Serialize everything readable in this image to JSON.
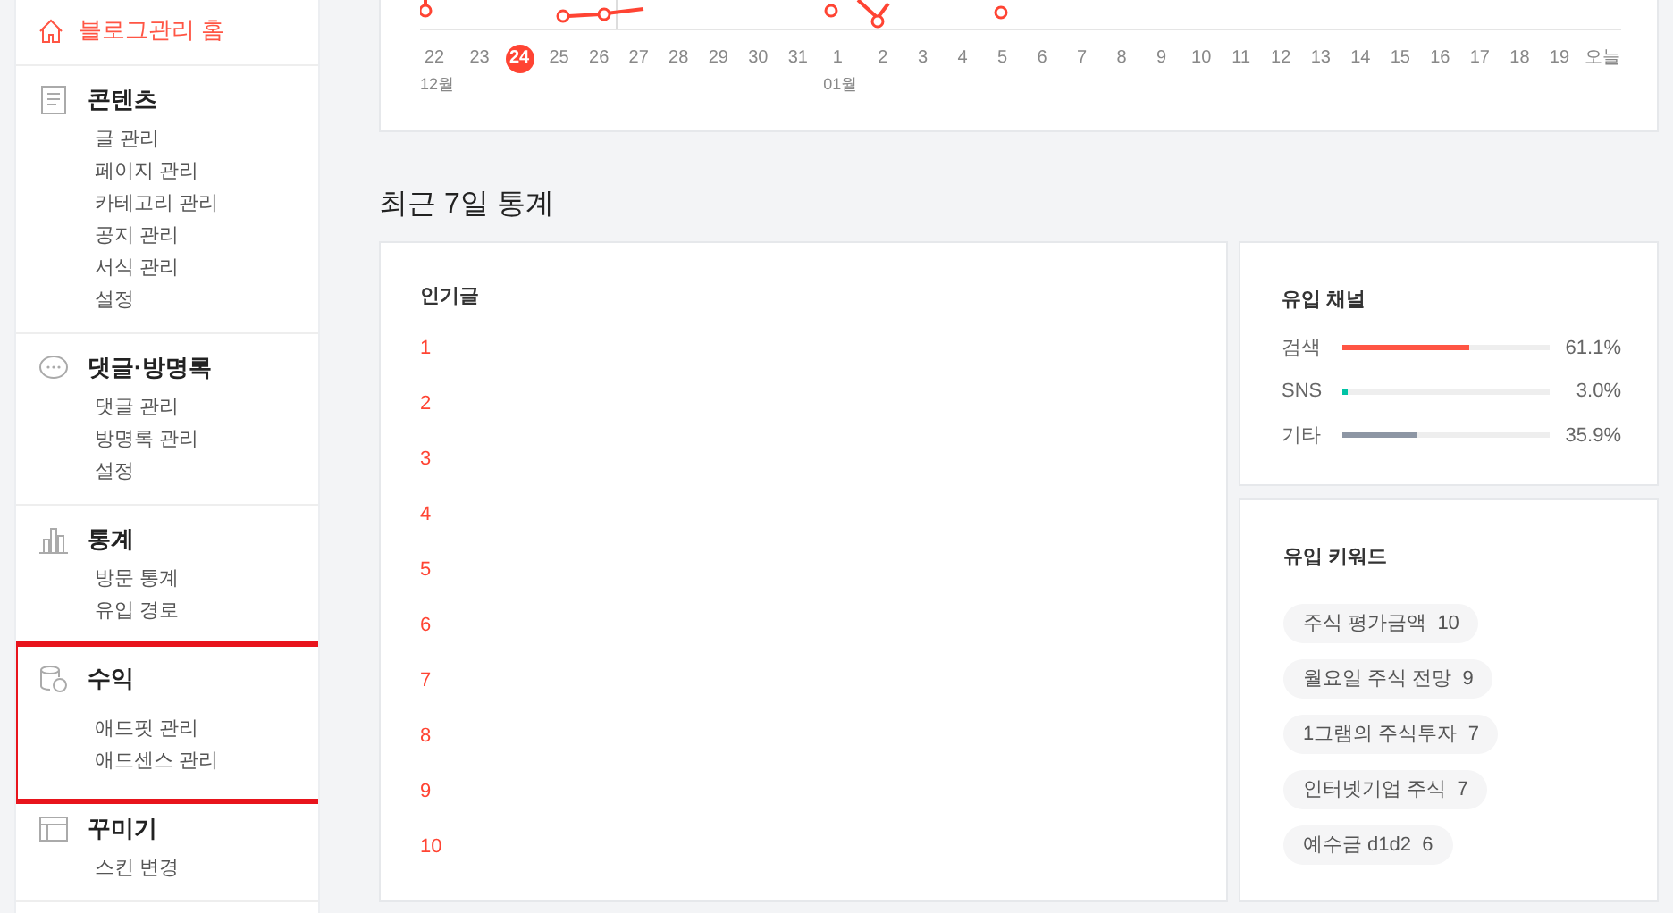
{
  "sidebar": {
    "home": {
      "label": "블로그관리 홈"
    },
    "sections": [
      {
        "kind": "contents",
        "title": "콘텐츠",
        "highlighted": false,
        "items": [
          "글 관리",
          "페이지 관리",
          "카테고리 관리",
          "공지 관리",
          "서식 관리",
          "설정"
        ]
      },
      {
        "kind": "comments",
        "title": "댓글·방명록",
        "highlighted": false,
        "items": [
          "댓글 관리",
          "방명록 관리",
          "설정"
        ]
      },
      {
        "kind": "stats",
        "title": "통계",
        "highlighted": false,
        "items": [
          "방문 통계",
          "유입 경로"
        ]
      },
      {
        "kind": "revenue",
        "title": "수익",
        "highlighted": true,
        "items": [
          "애드핏 관리",
          "애드센스 관리"
        ]
      },
      {
        "kind": "design",
        "title": "꾸미기",
        "highlighted": false,
        "items": [
          "스킨 변경"
        ]
      }
    ]
  },
  "visit_chart": {
    "days": [
      {
        "label": "22",
        "month": "12월",
        "selected": false
      },
      {
        "label": "23",
        "selected": false
      },
      {
        "label": "24",
        "selected": true
      },
      {
        "label": "25",
        "selected": false
      },
      {
        "label": "26",
        "selected": false
      },
      {
        "label": "27",
        "selected": false
      },
      {
        "label": "28",
        "selected": false
      },
      {
        "label": "29",
        "selected": false
      },
      {
        "label": "30",
        "selected": false
      },
      {
        "label": "31",
        "selected": false
      },
      {
        "label": "1",
        "month": "01월",
        "selected": false
      },
      {
        "label": "2",
        "selected": false
      },
      {
        "label": "3",
        "selected": false
      },
      {
        "label": "4",
        "selected": false
      },
      {
        "label": "5",
        "selected": false
      },
      {
        "label": "6",
        "selected": false
      },
      {
        "label": "7",
        "selected": false
      },
      {
        "label": "8",
        "selected": false
      },
      {
        "label": "9",
        "selected": false
      },
      {
        "label": "10",
        "selected": false
      },
      {
        "label": "11",
        "selected": false
      },
      {
        "label": "12",
        "selected": false
      },
      {
        "label": "13",
        "selected": false
      },
      {
        "label": "14",
        "selected": false
      },
      {
        "label": "15",
        "selected": false
      },
      {
        "label": "16",
        "selected": false
      },
      {
        "label": "17",
        "selected": false
      },
      {
        "label": "18",
        "selected": false
      },
      {
        "label": "19",
        "selected": false
      },
      {
        "label": "오늘",
        "selected": false
      }
    ]
  },
  "recent_heading": "최근 7일 통계",
  "popular": {
    "title": "인기글",
    "ranks": [
      "1",
      "2",
      "3",
      "4",
      "5",
      "6",
      "7",
      "8",
      "9",
      "10"
    ]
  },
  "channels": {
    "title": "유입 채널",
    "items": [
      {
        "name": "검색",
        "level": 0.611,
        "reading": "61.1%",
        "color": "#ff5544"
      },
      {
        "name": "SNS",
        "level": 0.03,
        "reading": "3.0%",
        "color": "#00c3a5"
      },
      {
        "name": "기타",
        "level": 0.359,
        "reading": "35.9%",
        "color": "#8d96a4"
      }
    ]
  },
  "keywords": {
    "title": "유입 키워드",
    "items": [
      {
        "text": "주식 평가금액",
        "count": "10"
      },
      {
        "text": "월요일 주식 전망",
        "count": "9"
      },
      {
        "text": "1그램의 주식투자",
        "count": "7"
      },
      {
        "text": "인터넷기업 주식",
        "count": "7"
      },
      {
        "text": "예수금 d1d2",
        "count": "6"
      }
    ]
  }
}
